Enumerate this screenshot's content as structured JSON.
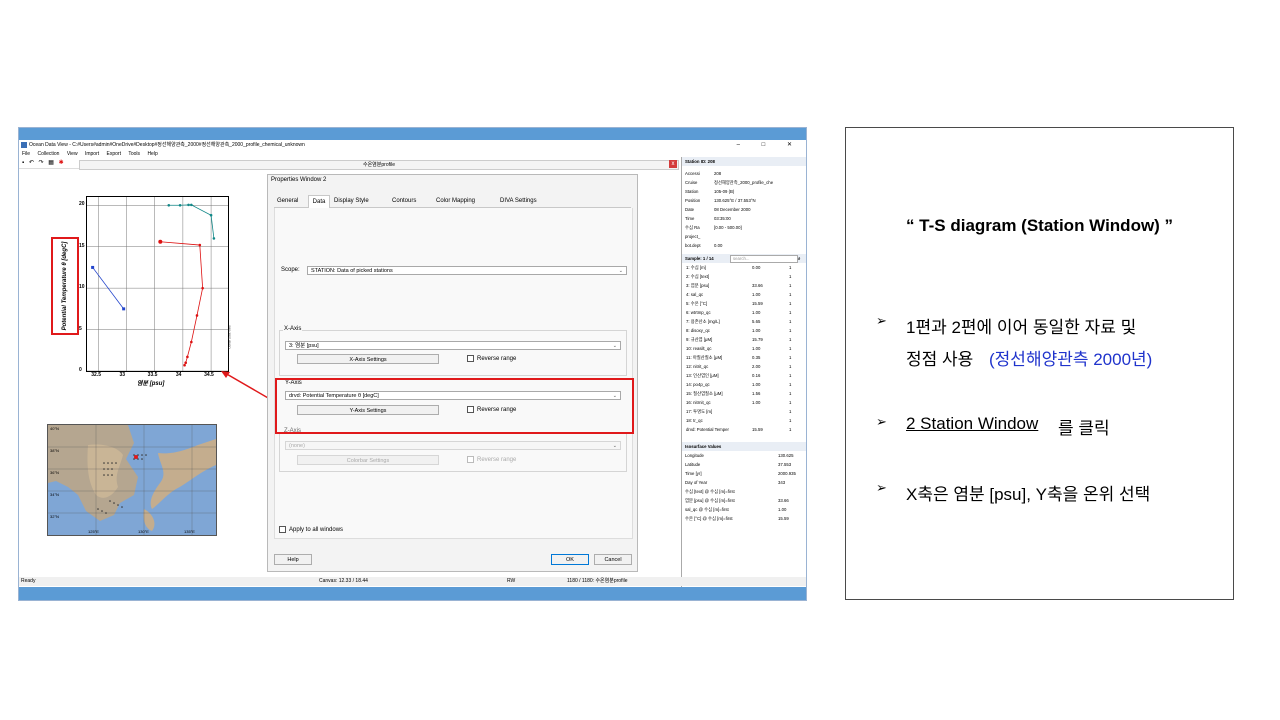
{
  "app": {
    "title": "Ocean Data View - C:#Users#admin#OneDrive#Desktop#정선해양관측_2000#정선해양관측_2000_profile_chemical_unknown",
    "window_controls": "– □ ✕",
    "menu": [
      "File",
      "Collection",
      "View",
      "Import",
      "Export",
      "Tools",
      "Help"
    ],
    "toolbar_icons": [
      "new-icon",
      "undo-icon",
      "redo-icon",
      "grid-icon",
      "crab-icon"
    ],
    "doc_title": "수온염분profile",
    "doc_close": "x"
  },
  "chart_data": {
    "type": "scatter",
    "xlabel": "염분 [psu]",
    "ylabel": "Potential Temperature θ [degC]",
    "xlim": [
      32.3,
      34.8
    ],
    "ylim": [
      0,
      21
    ],
    "x_ticks": [
      "32.5",
      "33",
      "33.5",
      "34",
      "34.5"
    ],
    "x_tick_values": [
      32.5,
      33,
      33.5,
      34,
      34.5
    ],
    "y_ticks": [
      "0",
      "5",
      "10",
      "15",
      "20"
    ],
    "y_tick_values": [
      0,
      5,
      10,
      15,
      20
    ],
    "side_label": "Ocean Data View",
    "series": [
      {
        "color": "#2244cc",
        "points": [
          [
            32.4,
            12.5
          ],
          [
            32.95,
            7.5
          ]
        ],
        "marker": "square"
      },
      {
        "color": "#dd1111",
        "points": [
          [
            33.6,
            15.6
          ],
          [
            34.3,
            15.2
          ],
          [
            34.35,
            10
          ],
          [
            34.25,
            6.7
          ],
          [
            34.15,
            3.5
          ],
          [
            34.08,
            1.7
          ],
          [
            34.05,
            1.0
          ],
          [
            34.03,
            0.7
          ]
        ],
        "marker": "cross"
      },
      {
        "color": "#118888",
        "points": [
          [
            33.75,
            20
          ],
          [
            33.95,
            20
          ],
          [
            34.1,
            20.05
          ],
          [
            34.15,
            20.05
          ],
          [
            34.5,
            18.8
          ],
          [
            34.55,
            16
          ]
        ],
        "marker": "dot"
      }
    ]
  },
  "map": {
    "lat_labels": [
      "40°N",
      "38°N",
      "36°N",
      "34°N",
      "32°N"
    ],
    "lon_labels": [
      "125°E",
      "130°E",
      "135°E"
    ],
    "side_label": "Ocean Data View"
  },
  "props": {
    "title": "Properties Window 2",
    "tabs": [
      "General",
      "Data",
      "Display Style",
      "Contours",
      "Color Mapping",
      "DIVA Settings"
    ],
    "scope_label": "Scope:",
    "scope_value": "STATION: Data of picked stations",
    "x_axis": {
      "label": "X-Axis",
      "value": "3: 염분 [psu]",
      "settings": "X-Axis Settings",
      "reverse": "Reverse range"
    },
    "y_axis": {
      "label": "Y-Axis",
      "value": "drvd: Potential Temperature θ [degC]",
      "settings": "Y-Axis Settings",
      "reverse": "Reverse range"
    },
    "z_axis": {
      "label": "Z-Axis",
      "value": "(none)",
      "settings": "Colorbar Settings",
      "reverse": "Reverse range"
    },
    "apply_all": "Apply to all windows",
    "help": "Help",
    "ok": "OK",
    "cancel": "Cancel"
  },
  "station": {
    "header": "Station ID: 208",
    "meta": [
      {
        "k": "Accessi",
        "v": "208"
      },
      {
        "k": "Cruise",
        "v": "정선해양관측_2000_profile_che"
      },
      {
        "k": "Station",
        "v": "105-09 (B)"
      },
      {
        "k": "Position",
        "v": "130.625°E / 37.553°N"
      },
      {
        "k": "Date",
        "v": "08 December 2000"
      },
      {
        "k": "Time",
        "v": "03:35:00"
      },
      {
        "k": "수심 Ra",
        "v": "[0.00 - 500.00]"
      },
      {
        "k": "project_",
        "v": ""
      },
      {
        "k": "bot.dept",
        "v": "0.00"
      }
    ],
    "sample_header": "Sample: 1 / 14",
    "search_placeholder": "search...",
    "samples": [
      {
        "k": "1: 수심 [m]",
        "v": "0.00",
        "n": "1"
      },
      {
        "k": "2: 수심 [text]",
        "v": "",
        "n": "1"
      },
      {
        "k": "3: 염분 [psu]",
        "v": "33.66",
        "n": "1"
      },
      {
        "k": "4: sal_qc",
        "v": "1.00",
        "n": "1"
      },
      {
        "k": "5: 수온 [°C]",
        "v": "15.59",
        "n": "1"
      },
      {
        "k": "6: wtrtmp_qc",
        "v": "1.00",
        "n": "1"
      },
      {
        "k": "7: 용존산소 [mg/L]",
        "v": "5.65",
        "n": "1"
      },
      {
        "k": "8: disoxy_qc",
        "v": "1.00",
        "n": "1"
      },
      {
        "k": "9: 규산염 [μM]",
        "v": "15.79",
        "n": "1"
      },
      {
        "k": "10: reasilt_qc",
        "v": "1.00",
        "n": "1"
      },
      {
        "k": "11: 아질산질소 [μM]",
        "v": "0.35",
        "n": "1"
      },
      {
        "k": "12: nitrit_qc",
        "v": "2.00",
        "n": "1"
      },
      {
        "k": "13: 인산염인 [μM]",
        "v": "0.16",
        "n": "1"
      },
      {
        "k": "14: po4p_qc",
        "v": "1.00",
        "n": "1"
      },
      {
        "k": "15: 질산염질소 [μM]",
        "v": "1.56",
        "n": "1"
      },
      {
        "k": "16: nitrnit_qc",
        "v": "1.00",
        "n": "1"
      },
      {
        "k": "17: 투명도 [m]",
        "v": "",
        "n": "1"
      },
      {
        "k": "18: tr_qc",
        "v": "",
        "n": "1"
      },
      {
        "k": "drvd: Potential Temper",
        "v": "15.59",
        "n": "1"
      }
    ],
    "iso_header": "Isosurface Values",
    "iso": [
      {
        "k": "Longitude",
        "v": "130.625"
      },
      {
        "k": "Latitude",
        "v": "37.553"
      },
      {
        "k": "Time [yr]",
        "v": "2000.935"
      },
      {
        "k": "Day of Year",
        "v": "343"
      },
      {
        "k": "수심 [text] @ 수심 [m]=first",
        "v": ""
      },
      {
        "k": "염분 [psu] @ 수심 [m]=first",
        "v": "33.66"
      },
      {
        "k": "sal_qc @ 수심 [m]=first",
        "v": "1.00"
      },
      {
        "k": "수온 [°C] @ 수심 [m]=first",
        "v": "15.59"
      }
    ]
  },
  "statusbar": {
    "ready": "Ready",
    "canvas": "Canvas: 12.33 / 18.44",
    "rw": "RW",
    "samples": "1180 / 1180: 수온염분profile"
  },
  "slide": {
    "title": "“ T-S diagram (Station Window) ”",
    "bullet1_line1": "1편과 2편에 이어 동일한 자료 및",
    "bullet1_line2a": "정점 사용",
    "bullet1_line2b": "(정선해양관측 2000년)",
    "bullet2a": "2 Station Window",
    "bullet2b": "를 클릭",
    "bullet3": "X축은 염분 [psu], Y축을 온위 선택",
    "arrow": "➢"
  }
}
